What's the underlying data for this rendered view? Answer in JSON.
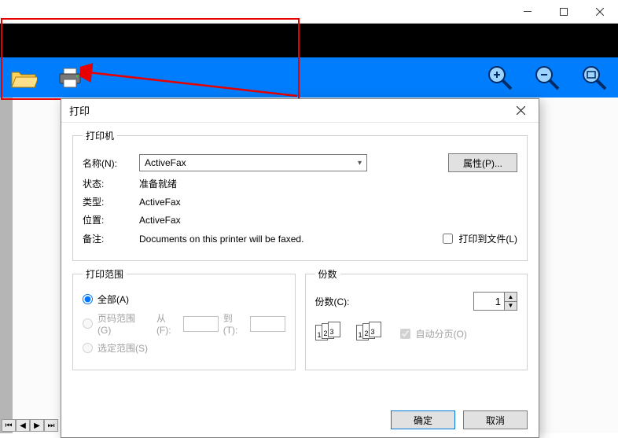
{
  "window": {
    "close": "✕"
  },
  "toolbar": {
    "zoom_in": "+",
    "zoom_out": "−",
    "zoom_fit": "⊡"
  },
  "dialog": {
    "title": "打印",
    "printer": {
      "legend": "打印机",
      "name_label": "名称(N):",
      "name_value": "ActiveFax",
      "properties_btn": "属性(P)...",
      "status_label": "状态:",
      "status_value": "准备就绪",
      "type_label": "类型:",
      "type_value": "ActiveFax",
      "location_label": "位置:",
      "location_value": "ActiveFax",
      "comment_label": "备注:",
      "comment_value": "Documents on this printer will be faxed.",
      "print_to_file": "打印到文件(L)"
    },
    "range": {
      "legend": "打印范围",
      "all": "全部(A)",
      "pages": "页码范围(G)",
      "from": "从(F):",
      "to": "到(T):",
      "selection": "选定范围(S)"
    },
    "copies": {
      "legend": "份数",
      "copies_label": "份数(C):",
      "copies_value": "1",
      "collate": "自动分页(O)"
    },
    "ok": "确定",
    "cancel": "取消"
  }
}
